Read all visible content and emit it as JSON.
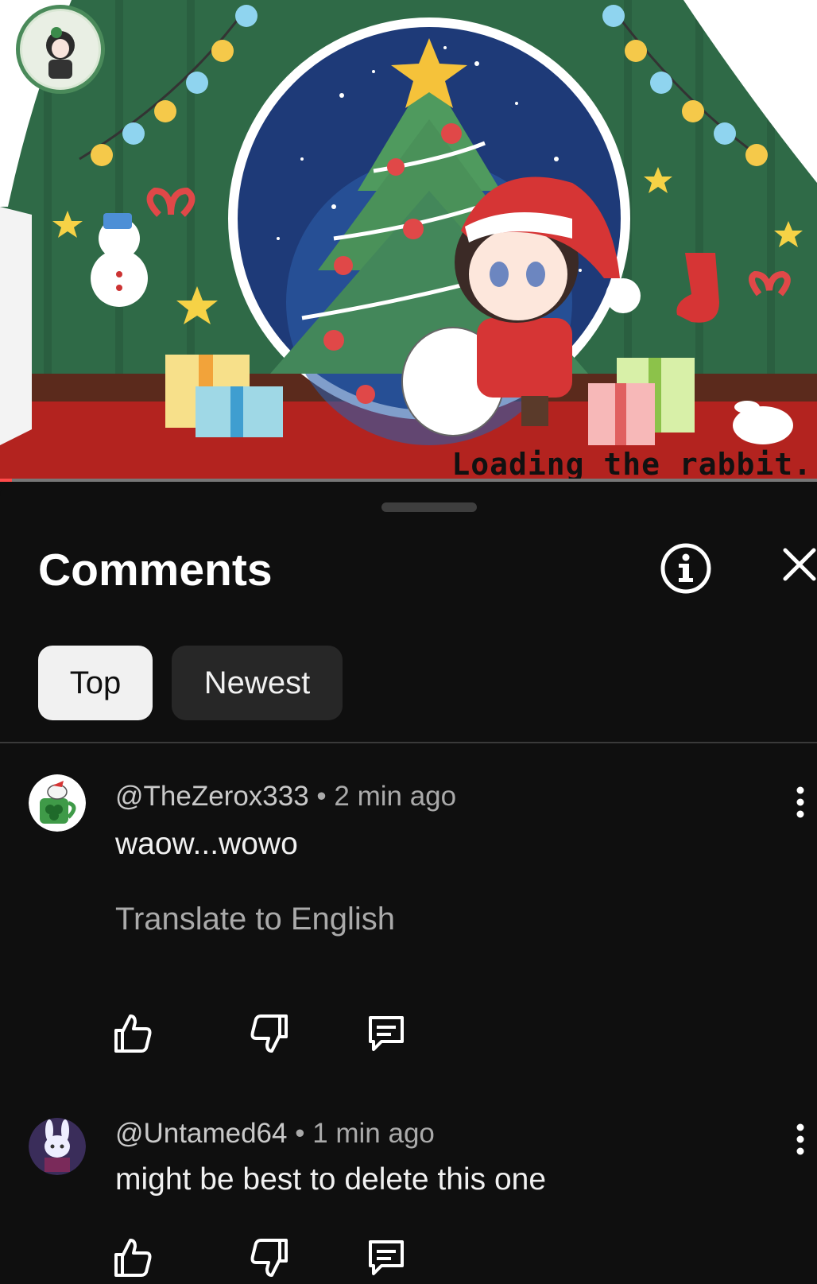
{
  "video": {
    "caption": "Loading the rabbit.",
    "progress": 0.015,
    "colors": {
      "curtain_green": "#2f6a47",
      "floor_red": "#b3231f",
      "sky_blue": "#1e3a78"
    }
  },
  "sheet": {
    "title": "Comments",
    "info_icon": "info-icon",
    "close_icon": "close-icon"
  },
  "filters": {
    "top": "Top",
    "newest": "Newest",
    "selected": "Top"
  },
  "comments": [
    {
      "handle": "@TheZerox333",
      "separator": " • ",
      "time": "2 min ago",
      "text": "waow...wowo",
      "translate": "Translate to English",
      "avatar_icon": "clover-mug-avatar",
      "actions": [
        "like-icon",
        "dislike-icon",
        "reply-icon"
      ]
    },
    {
      "handle": "@Untamed64",
      "separator": " • ",
      "time": "1 min ago",
      "text": "might be best to delete this one",
      "avatar_icon": "rabbit-avatar",
      "actions": [
        "like-icon",
        "dislike-icon",
        "reply-icon"
      ]
    }
  ],
  "colors": {
    "background": "#0f0f0f",
    "chip_selected": "#f1f1f1",
    "chip_unselected": "#272727",
    "secondary_text": "#aaaaaa"
  }
}
